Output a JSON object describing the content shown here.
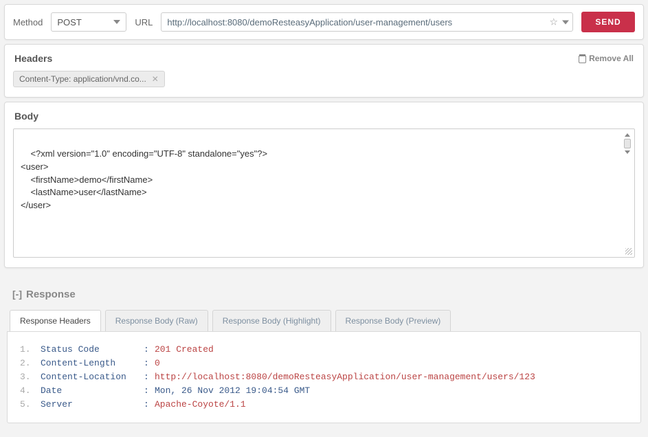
{
  "request": {
    "method_label": "Method",
    "method_value": "POST",
    "url_label": "URL",
    "url_value": "http://localhost:8080/demoResteasyApplication/user-management/users",
    "send_label": "SEND"
  },
  "headers": {
    "title": "Headers",
    "remove_all": "Remove All",
    "tags": [
      "Content-Type: application/vnd.co..."
    ]
  },
  "body": {
    "title": "Body",
    "content": "<?xml version=\"1.0\" encoding=\"UTF-8\" standalone=\"yes\"?>\n<user>\n    <firstName>demo</firstName>\n    <lastName>user</lastName>\n</user>"
  },
  "response": {
    "collapse": "[-]",
    "title": "Response",
    "tabs": {
      "headers": "Response Headers",
      "raw": "Response Body (Raw)",
      "highlight": "Response Body (Highlight)",
      "preview": "Response Body (Preview)"
    },
    "rows": [
      {
        "n": "1.",
        "key": "Status Code",
        "val": "201 Created",
        "cls": "val-red"
      },
      {
        "n": "2.",
        "key": "Content-Length",
        "val": "0",
        "cls": "val-red"
      },
      {
        "n": "3.",
        "key": "Content-Location",
        "val": "http://localhost:8080/demoResteasyApplication/user-management/users/123",
        "cls": "val-red"
      },
      {
        "n": "4.",
        "key": "Date",
        "val": "Mon, 26 Nov 2012 19:04:54 GMT",
        "cls": "val-blue"
      },
      {
        "n": "5.",
        "key": "Server",
        "val": "Apache-Coyote/1.1",
        "cls": "val-red"
      }
    ]
  }
}
